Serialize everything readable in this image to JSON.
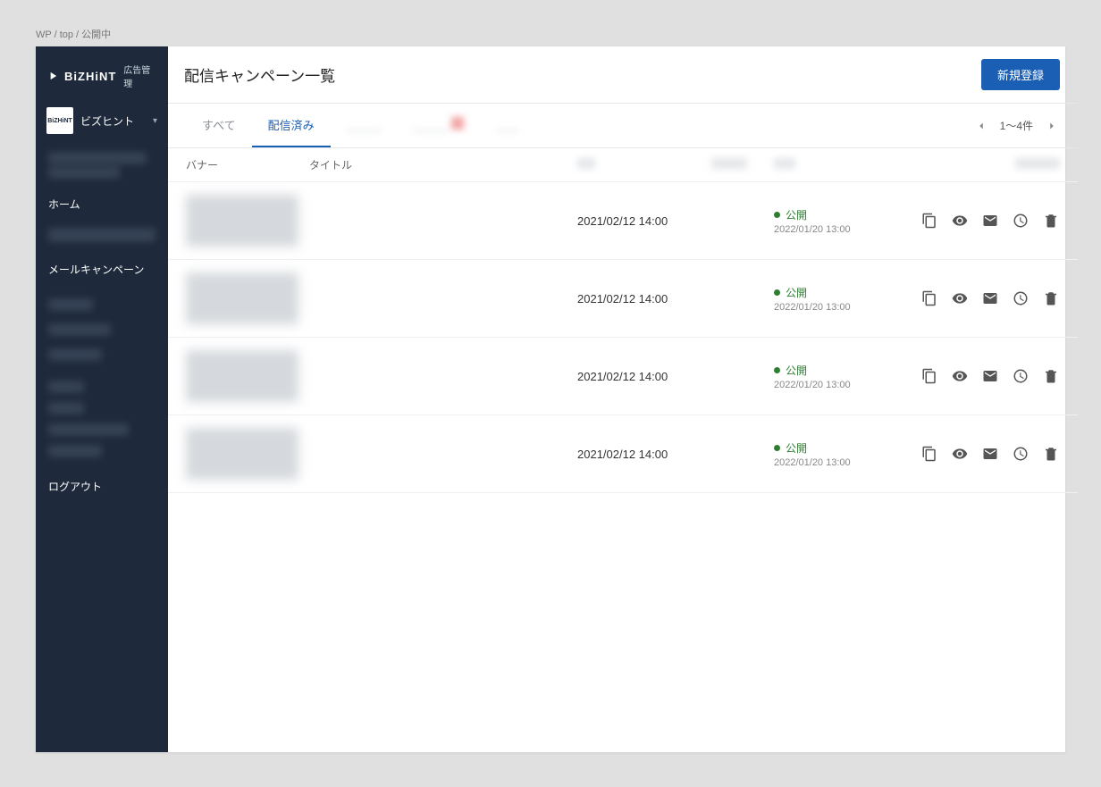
{
  "breadcrumb": "WP / top / 公開中",
  "brand": {
    "name": "BiZHiNT",
    "sub": "広告管理"
  },
  "org": {
    "avatar_label": "BiZHiNT",
    "name": "ビズヒント"
  },
  "nav": {
    "home": "ホーム",
    "mail_campaign": "メールキャンペーン",
    "logout": "ログアウト"
  },
  "page_title": "配信キャンペーン一覧",
  "button_new": "新規登録",
  "tabs": {
    "all": "すべて",
    "delivered": "配信済み"
  },
  "pager": {
    "range": "1〜4件"
  },
  "columns": {
    "banner": "バナー",
    "title": "タイトル"
  },
  "status_label": "公開",
  "rows": [
    {
      "date": "2021/02/12 14:00",
      "status_sub": "2022/01/20 13:00"
    },
    {
      "date": "2021/02/12 14:00",
      "status_sub": "2022/01/20 13:00"
    },
    {
      "date": "2021/02/12 14:00",
      "status_sub": "2022/01/20 13:00"
    },
    {
      "date": "2021/02/12 14:00",
      "status_sub": "2022/01/20 13:00"
    }
  ]
}
